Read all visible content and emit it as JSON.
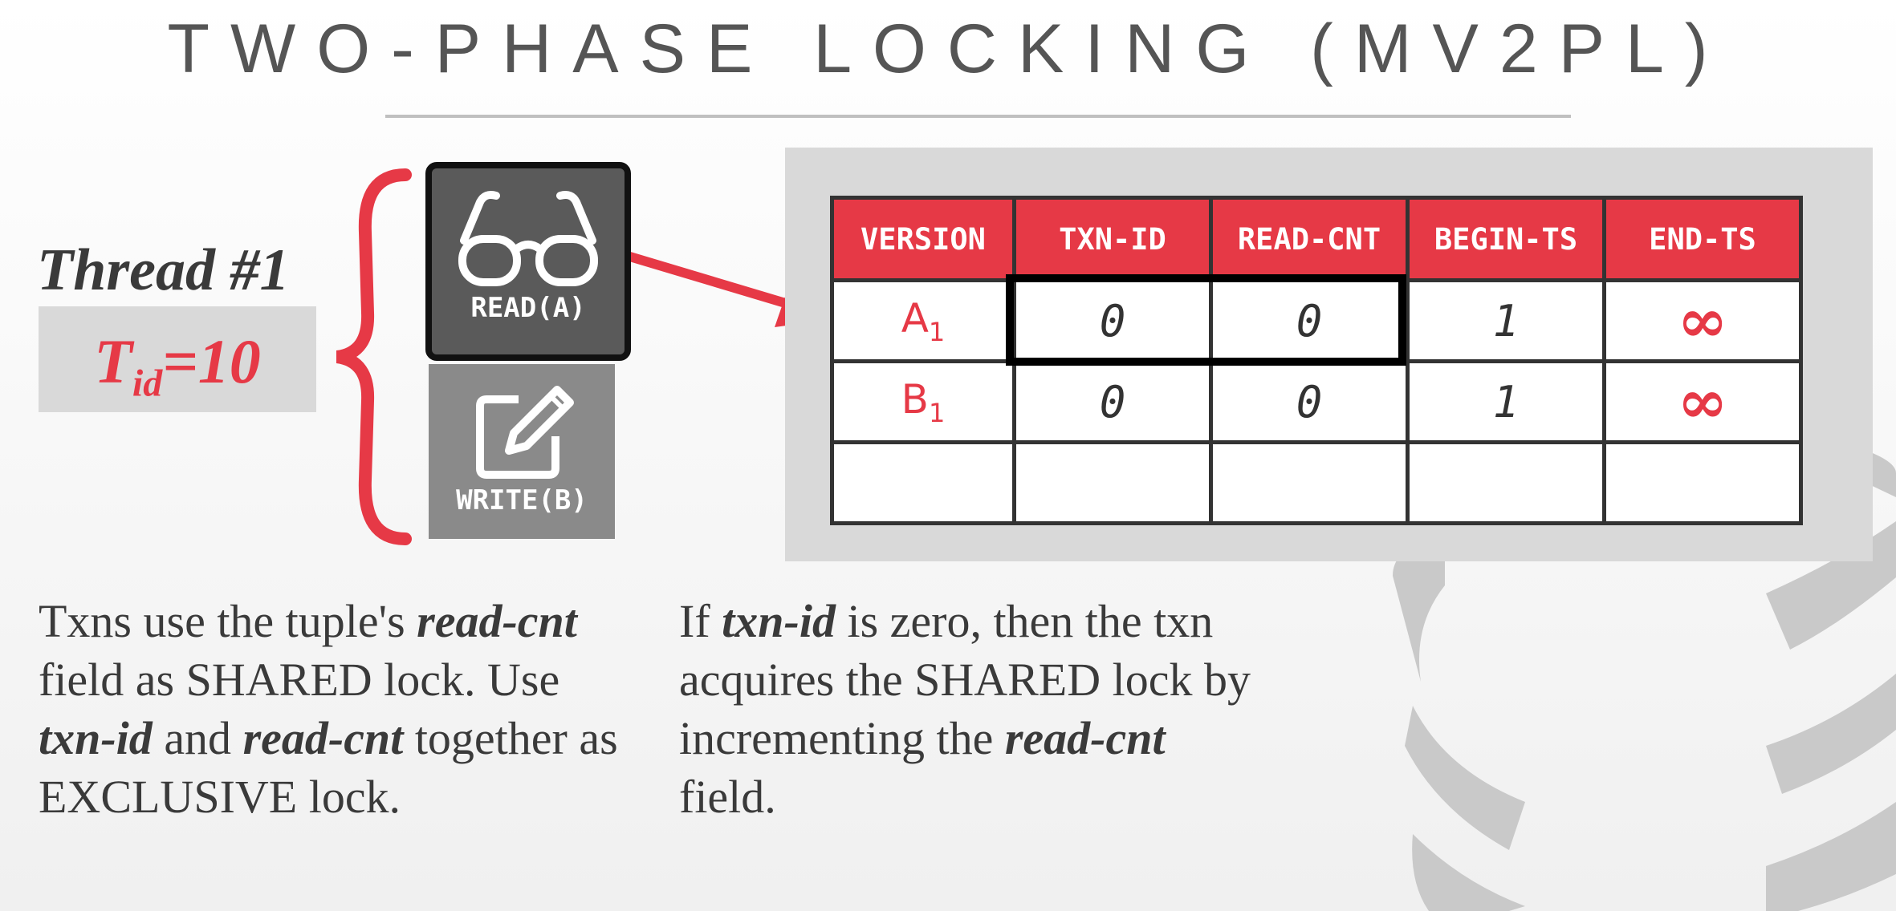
{
  "title": "TWO-PHASE LOCKING (MV2PL)",
  "colors": {
    "accent": "#e63946",
    "text": "#3a3a3a",
    "panel": "#d9d9d9",
    "title": "#555555"
  },
  "thread": {
    "label": "Thread #1",
    "tid_prefix": "T",
    "tid_sub": "id",
    "tid_value": "=10"
  },
  "operations": [
    {
      "label": "READ(A)",
      "icon": "glasses-icon",
      "active": true
    },
    {
      "label": "WRITE(B)",
      "icon": "edit-icon",
      "active": false
    }
  ],
  "table": {
    "headers": [
      "VERSION",
      "TXN-ID",
      "READ-CNT",
      "BEGIN-TS",
      "END-TS"
    ],
    "rows": [
      {
        "version": "A",
        "version_sub": "1",
        "txn_id": "0",
        "read_cnt": "0",
        "begin_ts": "1",
        "end_ts": "∞"
      },
      {
        "version": "B",
        "version_sub": "1",
        "txn_id": "0",
        "read_cnt": "0",
        "begin_ts": "1",
        "end_ts": "∞"
      }
    ]
  },
  "text_left": {
    "t1": "Txns use the tuple's ",
    "b1": "read-cnt",
    "t2": " field as SHARED lock. Use ",
    "b2": "txn-id",
    "t3": " and ",
    "b3": "read-cnt",
    "t4": " together as EXCLUSIVE lock."
  },
  "text_right": {
    "t1": "If ",
    "b1": "txn-id",
    "t2": " is zero, then the txn acquires the SHARED lock by incrementing the ",
    "b2": "read-cnt",
    "t3": " field."
  }
}
